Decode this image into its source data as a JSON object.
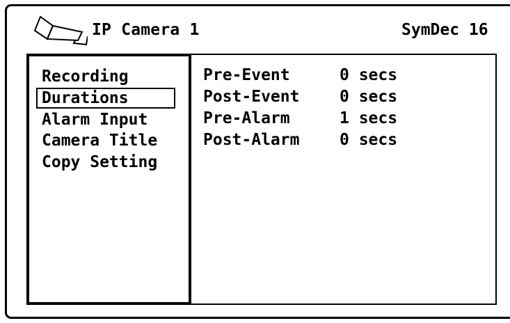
{
  "header": {
    "icon": "camera-icon",
    "title": "IP Camera 1",
    "date": "SymDec 16"
  },
  "menu": {
    "items": [
      {
        "label": "Recording"
      },
      {
        "label": "Durations",
        "selected": true
      },
      {
        "label": "Alarm Input"
      },
      {
        "label": "Camera Title"
      },
      {
        "label": "Copy Setting"
      }
    ]
  },
  "settings": [
    {
      "label": "Pre-Event",
      "value": "0 secs"
    },
    {
      "label": "Post-Event",
      "value": "0 secs"
    },
    {
      "label": "Pre-Alarm",
      "value": "1 secs"
    },
    {
      "label": "Post-Alarm",
      "value": "0 secs"
    }
  ]
}
